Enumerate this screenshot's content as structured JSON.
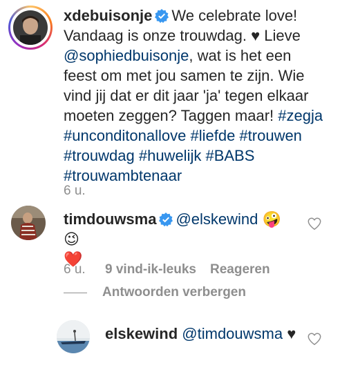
{
  "caption": {
    "username": "xdebuisonje",
    "text1": "We celebrate love! Vandaag is onze trouwdag. ",
    "heart": "♥",
    "text2": " Lieve ",
    "mention": "@sophiedbuisonje",
    "text3": ", wat is het een feest om met jou samen te zijn. Wie vind jij dat er dit jaar 'ja' tegen elkaar moeten zeggen? Taggen maar! ",
    "hashtags": "#zegja #unconditonallove #liefde #trouwen #trouwdag #huwelijk #BABS #trouwambtenaar",
    "time": "6 u."
  },
  "comment1": {
    "username": "timdouwsma",
    "mention": "@elskewind",
    "emojis": "🤪 😉",
    "heart_emoji": "❤️",
    "time": "6 u.",
    "likes": "9 vind-ik-leuks",
    "reply": "Reageren",
    "hide_replies": "Antwoorden verbergen"
  },
  "reply1": {
    "username": "elskewind",
    "mention": "@timdouwsma",
    "heart": "♥"
  },
  "colors": {
    "link": "#00376b",
    "verified": "#3897f0",
    "meta": "#8e8e8e",
    "text": "#262626"
  }
}
